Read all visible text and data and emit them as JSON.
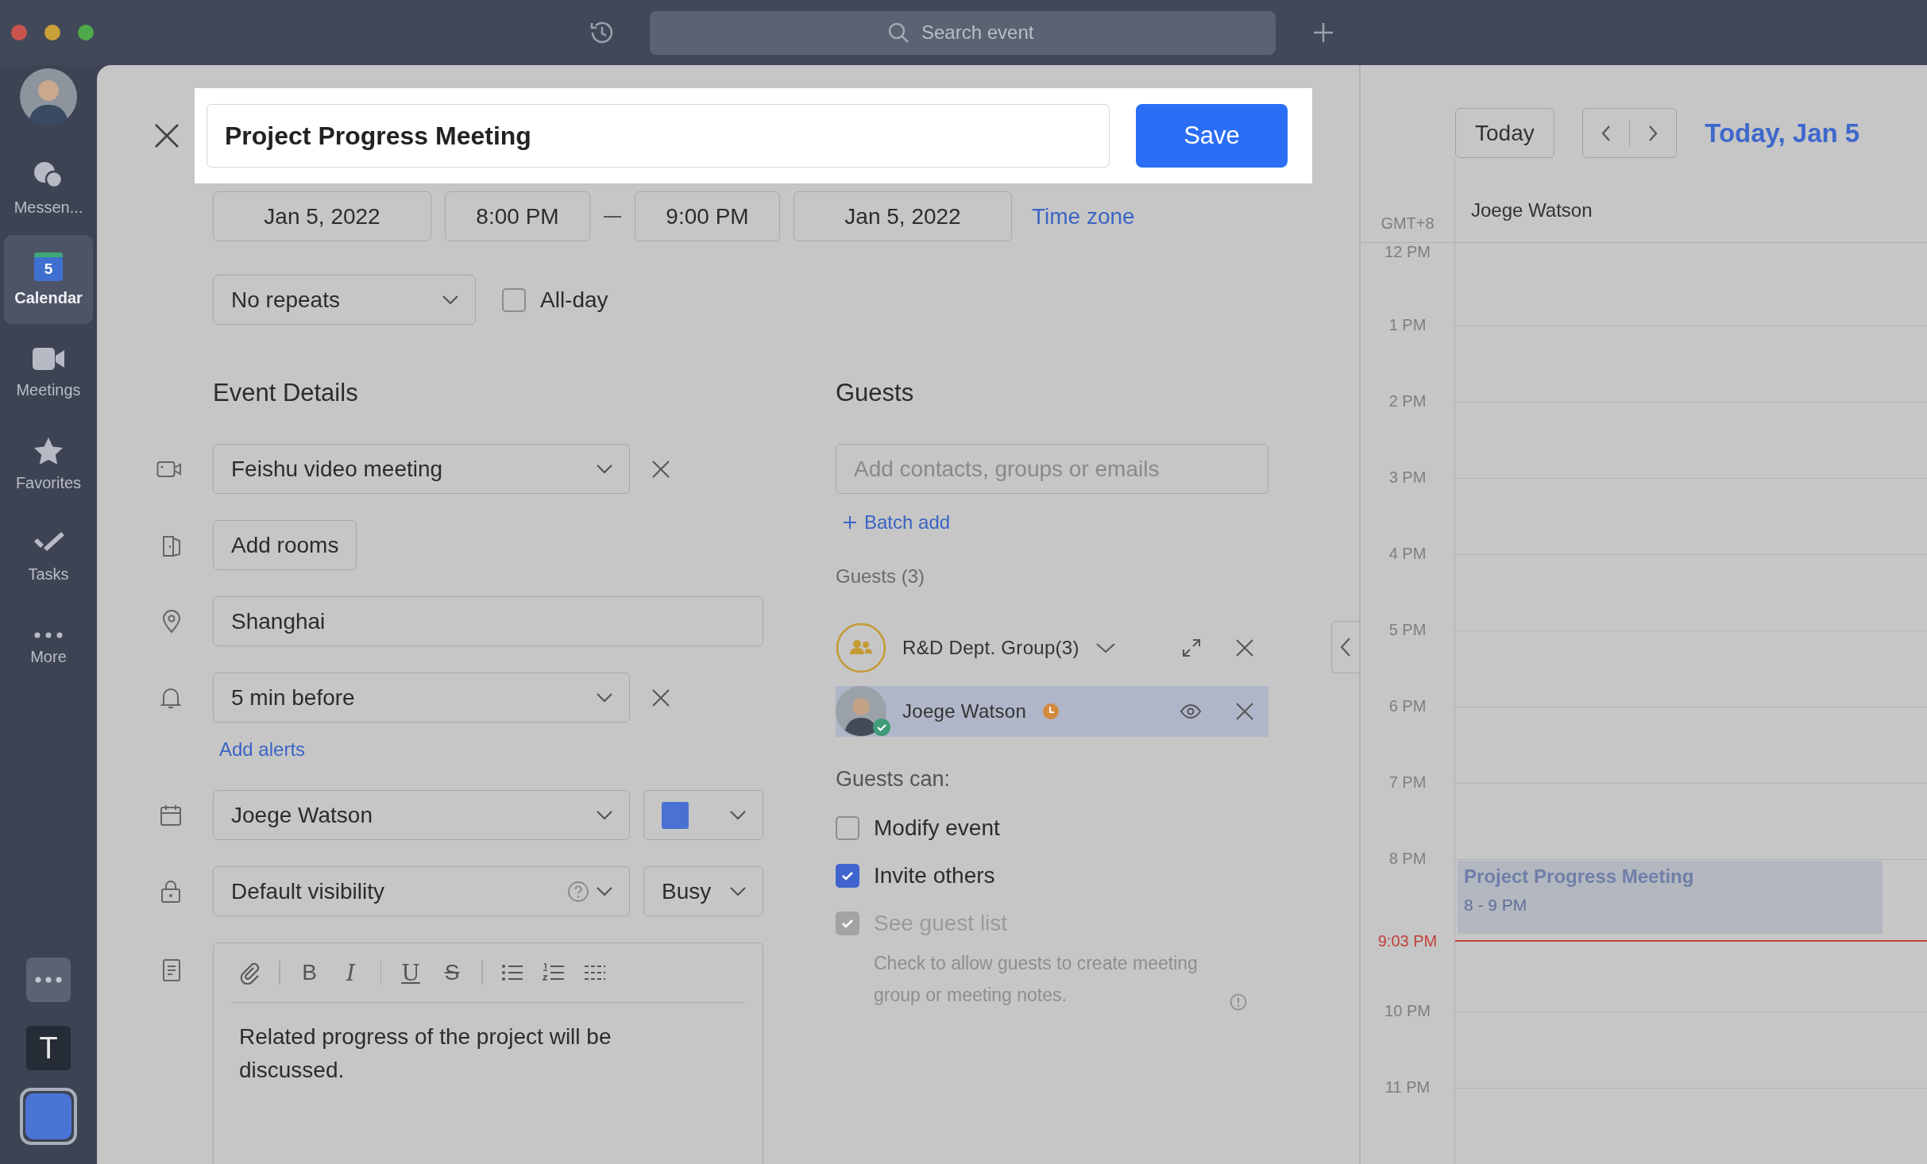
{
  "window": {
    "search_placeholder": "Search event"
  },
  "sidebar": {
    "items": [
      {
        "kind": "messenger",
        "label": "Messen...",
        "selected": false
      },
      {
        "kind": "calendar",
        "label": "Calendar",
        "badge": "5",
        "selected": true
      },
      {
        "kind": "meetings",
        "label": "Meetings",
        "selected": false
      },
      {
        "kind": "favorites",
        "label": "Favorites",
        "selected": false
      },
      {
        "kind": "tasks",
        "label": "Tasks",
        "selected": false
      },
      {
        "kind": "more",
        "label": "More",
        "selected": false
      }
    ],
    "apps": [
      {
        "kind": "dots"
      },
      {
        "kind": "letter",
        "label": "T"
      },
      {
        "kind": "blank",
        "selected": true
      }
    ]
  },
  "event": {
    "title": "Project Progress Meeting",
    "save": "Save",
    "start_date": "Jan 5, 2022",
    "start_time": "8:00 PM",
    "end_time": "9:00 PM",
    "end_date": "Jan 5, 2022",
    "time_zone": "Time zone",
    "repeat": "No repeats",
    "all_day": {
      "label": "All-day",
      "checked": false
    }
  },
  "details": {
    "heading": "Event Details",
    "video": "Feishu video meeting",
    "rooms_button": "Add rooms",
    "location": "Shanghai",
    "alert": "5 min before",
    "add_alerts": "Add alerts",
    "calendar": "Joege Watson",
    "visibility": "Default visibility",
    "availability": "Busy",
    "toolbar": [
      {
        "kind": "attach"
      },
      {
        "kind": "separator"
      },
      {
        "kind": "bold",
        "label": "B"
      },
      {
        "kind": "italic",
        "label": "I"
      },
      {
        "kind": "separator"
      },
      {
        "kind": "underline",
        "label": "U"
      },
      {
        "kind": "strike",
        "label": "S"
      },
      {
        "kind": "separator"
      },
      {
        "kind": "bullets"
      },
      {
        "kind": "numbers"
      },
      {
        "kind": "checklist"
      }
    ],
    "description": "Related progress of the project will be discussed."
  },
  "guests": {
    "heading": "Guests",
    "placeholder": "Add contacts, groups or emails",
    "batch_add": "Batch add",
    "count_label": "Guests (3)",
    "list": [
      {
        "kind": "group",
        "name": "R&D Dept. Group(3)",
        "selected": false
      },
      {
        "kind": "person",
        "name": "Joege Watson",
        "selected": true
      }
    ],
    "can_label": "Guests can:",
    "permissions": [
      {
        "label": "Modify event",
        "checked": false,
        "disabled": false
      },
      {
        "label": "Invite others",
        "checked": true,
        "disabled": false
      },
      {
        "label": "See guest list",
        "checked": true,
        "disabled": true
      }
    ],
    "note": "Check to allow guests to create meeting group or meeting notes."
  },
  "calendar": {
    "today_button": "Today",
    "date_title": "Today, Jan 5",
    "timezone": "GMT+8",
    "column": "Joege Watson",
    "hours": [
      {
        "kind": "hour",
        "label": "12 PM"
      },
      {
        "kind": "hour",
        "label": "1 PM"
      },
      {
        "kind": "hour",
        "label": "2 PM"
      },
      {
        "kind": "hour",
        "label": "3 PM"
      },
      {
        "kind": "hour",
        "label": "4 PM"
      },
      {
        "kind": "hour",
        "label": "5 PM"
      },
      {
        "kind": "hour",
        "label": "6 PM"
      },
      {
        "kind": "hour",
        "label": "7 PM"
      },
      {
        "kind": "hour",
        "label": "8 PM",
        "event": {
          "title": "Project Progress Meeting",
          "time": "8 - 9 PM"
        }
      },
      {
        "kind": "now",
        "label": "9:03 PM"
      },
      {
        "kind": "hour",
        "label": "10 PM"
      },
      {
        "kind": "hour",
        "label": "11 PM"
      }
    ]
  }
}
